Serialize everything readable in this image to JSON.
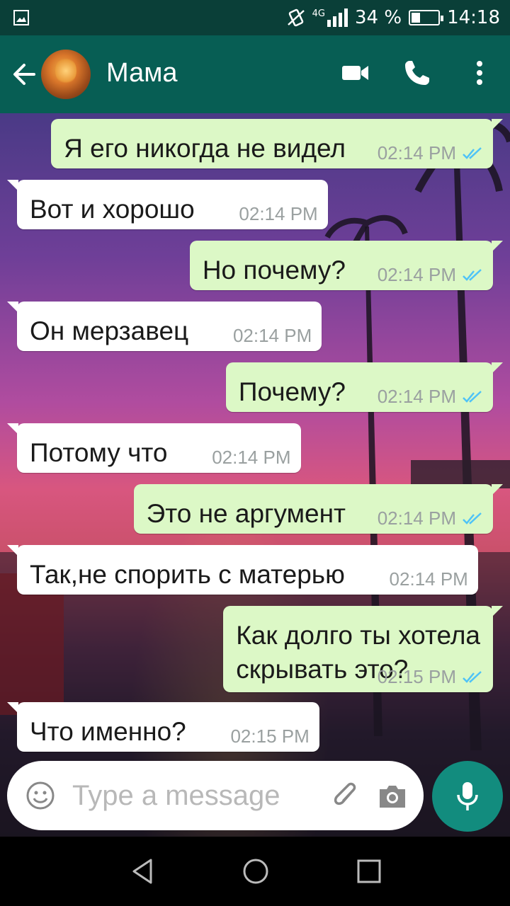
{
  "status_bar": {
    "network": "4G",
    "battery_text": "34 %",
    "battery_level": 0.34,
    "time": "14:18"
  },
  "header": {
    "contact_name": "Мама",
    "icons": [
      "back-arrow-icon",
      "video-call-icon",
      "phone-icon",
      "more-vert-icon"
    ]
  },
  "messages": [
    {
      "dir": "out",
      "text": "Я его никогда не видел",
      "time": "02:14 PM",
      "read": true
    },
    {
      "dir": "in",
      "text": "Вот и хорошо",
      "time": "02:14 PM"
    },
    {
      "dir": "out",
      "text": "Но почему?",
      "time": "02:14 PM",
      "read": true
    },
    {
      "dir": "in",
      "text": "Он мерзавец",
      "time": "02:14 PM"
    },
    {
      "dir": "out",
      "text": "Почему?",
      "time": "02:14 PM",
      "read": true
    },
    {
      "dir": "in",
      "text": "Потому что",
      "time": "02:14 PM"
    },
    {
      "dir": "out",
      "text": "Это не аргумент",
      "time": "02:14 PM",
      "read": true
    },
    {
      "dir": "in",
      "text": "Так,не спорить с матерью",
      "time": "02:14 PM"
    },
    {
      "dir": "out",
      "text": "Как долго ты хотела\nскрывать это?",
      "time": "02:15 PM",
      "read": true
    },
    {
      "dir": "in",
      "text": "Что именно?",
      "time": "02:15 PM"
    }
  ],
  "composer": {
    "placeholder": "Type a message",
    "value": ""
  },
  "colors": {
    "header": "#075e54",
    "status_bar": "#0a3f38",
    "outgoing_bubble": "#dcf8c6",
    "incoming_bubble": "#ffffff",
    "mic_button": "#128c7e",
    "read_ticks": "#4fc3f7"
  }
}
